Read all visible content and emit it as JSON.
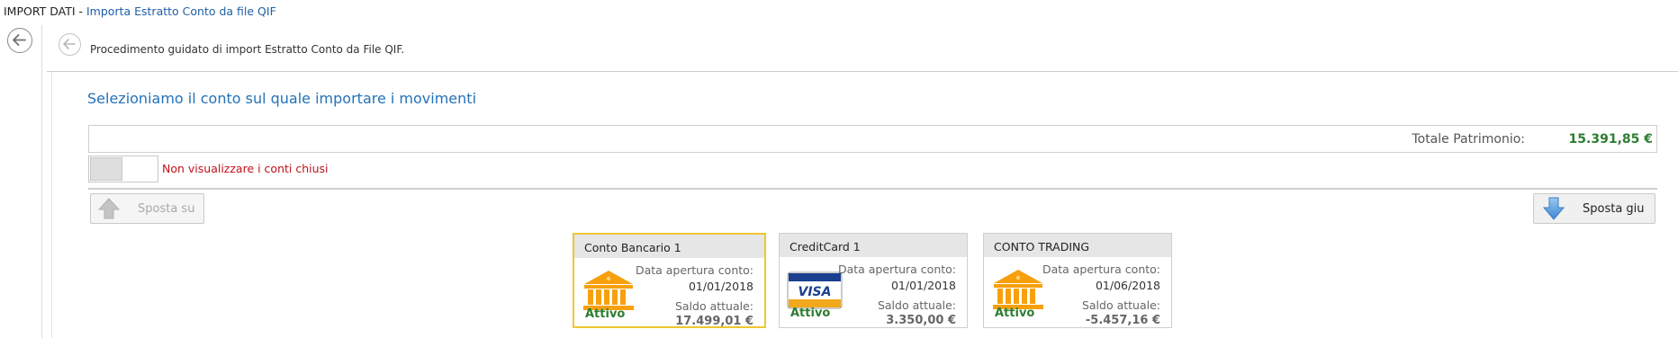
{
  "titlebar": {
    "prefix": "IMPORT DATI - ",
    "title": "Importa Estratto Conto da file QIF"
  },
  "wizard": {
    "description": "Procedimento guidato di import Estratto Conto da File QIF.",
    "heading": "Selezioniamo il conto sul quale importare i movimenti"
  },
  "summary": {
    "total_label": "Totale Patrimonio:",
    "total_value": "15.391,85 €"
  },
  "filter": {
    "hide_closed_label": "Non visualizzare i conti chiusi",
    "hide_closed_on": false
  },
  "toolbar": {
    "move_up_label": "Sposta su",
    "move_down_label": "Sposta giu"
  },
  "accounts": [
    {
      "name": "Conto Bancario 1",
      "icon": "bank-icon",
      "status": "Attivo",
      "open_label": "Data apertura conto:",
      "open_date": "01/01/2018",
      "balance_label": "Saldo attuale:",
      "balance": "17.499,01 €",
      "selected": true
    },
    {
      "name": "CreditCard 1",
      "icon": "visa-card-icon",
      "status": "Attivo",
      "open_label": "Data apertura conto:",
      "open_date": "01/01/2018",
      "balance_label": "Saldo attuale:",
      "balance": "3.350,00 €",
      "selected": false
    },
    {
      "name": "CONTO TRADING",
      "icon": "bank-icon",
      "status": "Attivo",
      "open_label": "Data apertura conto:",
      "open_date": "01/06/2018",
      "balance_label": "Saldo attuale:",
      "balance": "-5.457,16 €",
      "selected": false
    }
  ],
  "colors": {
    "accent_blue": "#2472b8",
    "positive_green": "#2e7d32",
    "negative_red": "#c0121a",
    "selection_yellow": "#f0c630"
  }
}
